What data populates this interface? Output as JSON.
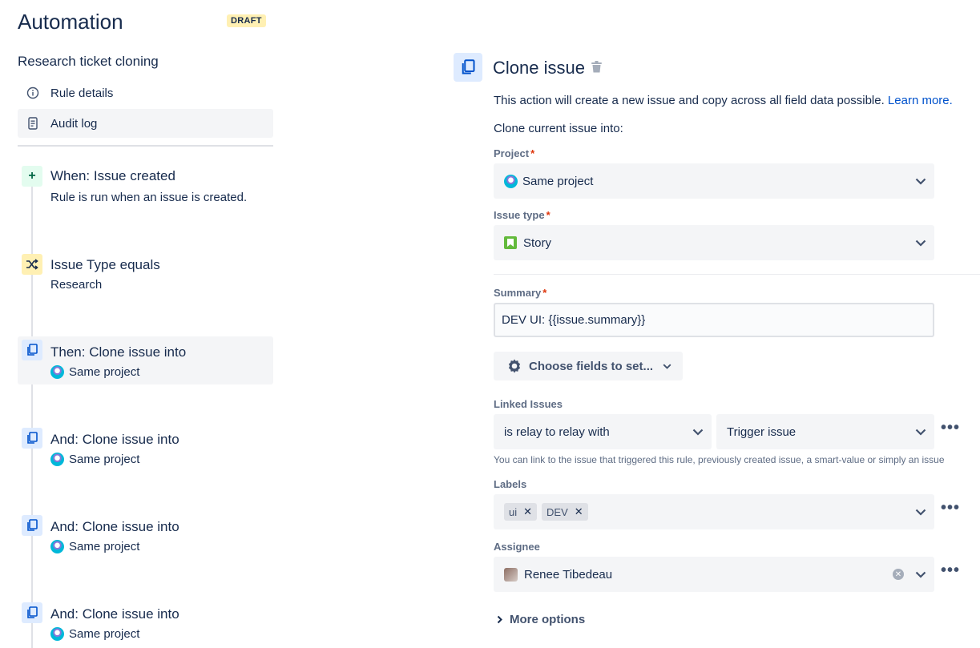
{
  "header": {
    "title": "Automation",
    "status_badge": "DRAFT"
  },
  "rule": {
    "name": "Research ticket cloning"
  },
  "sidebar_nav": [
    {
      "label": "Rule details",
      "icon": "info-icon"
    },
    {
      "label": "Audit log",
      "icon": "document-icon"
    }
  ],
  "steps": [
    {
      "title": "When: Issue created",
      "subtitle": "Rule is run when an issue is created.",
      "icon": "plus-icon"
    },
    {
      "title": "Issue Type equals",
      "subtitle": "Research",
      "icon": "shuffle-icon"
    },
    {
      "title": "Then: Clone issue into",
      "subtitle": "Same project",
      "icon": "copy-icon"
    },
    {
      "title": "And: Clone issue into",
      "subtitle": "Same project",
      "icon": "copy-icon"
    },
    {
      "title": "And: Clone issue into",
      "subtitle": "Same project",
      "icon": "copy-icon"
    },
    {
      "title": "And: Clone issue into",
      "subtitle": "Same project",
      "icon": "copy-icon"
    }
  ],
  "panel": {
    "title": "Clone issue",
    "description": "This action will create a new issue and copy across all field data possible.",
    "learn_more": "Learn more.",
    "clone_into": "Clone current issue into:",
    "project": {
      "label": "Project",
      "value": "Same project"
    },
    "issue_type": {
      "label": "Issue type",
      "value": "Story"
    },
    "summary": {
      "label": "Summary",
      "value": "DEV UI: {{issue.summary}}"
    },
    "choose_fields": "Choose fields to set...",
    "linked_issues": {
      "label": "Linked Issues",
      "relation": "is relay to relay with",
      "target": "Trigger issue",
      "help": "You can link to the issue that triggered this rule, previously created issue, a smart-value or simply an issue"
    },
    "labels": {
      "label": "Labels",
      "tags": [
        "ui",
        "DEV"
      ]
    },
    "assignee": {
      "label": "Assignee",
      "value": "Renee Tibedeau"
    },
    "more_options": "More options"
  },
  "colors": {
    "primary": "#0052cc",
    "text": "#172b4d",
    "draft": "#fff0b3",
    "trigger": "#e3fcef"
  }
}
